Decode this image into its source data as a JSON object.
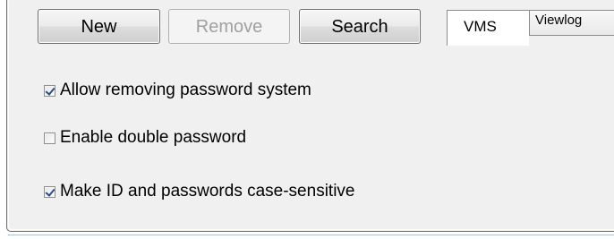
{
  "toolbar": {
    "new_label": "New",
    "remove_label": "Remove",
    "search_label": "Search"
  },
  "tabs": [
    {
      "label": "VMS",
      "selected": true
    },
    {
      "label": "Viewlog",
      "selected": false
    }
  ],
  "options": [
    {
      "label": "Allow removing password system",
      "checked": true
    },
    {
      "label": "Enable double password",
      "checked": false
    },
    {
      "label": "Make ID and passwords case-sensitive",
      "checked": true
    }
  ],
  "colors": {
    "panel_background": "#f0f0f0",
    "check_mark": "#2c4a8a",
    "disabled_text": "#a0a0a0"
  }
}
